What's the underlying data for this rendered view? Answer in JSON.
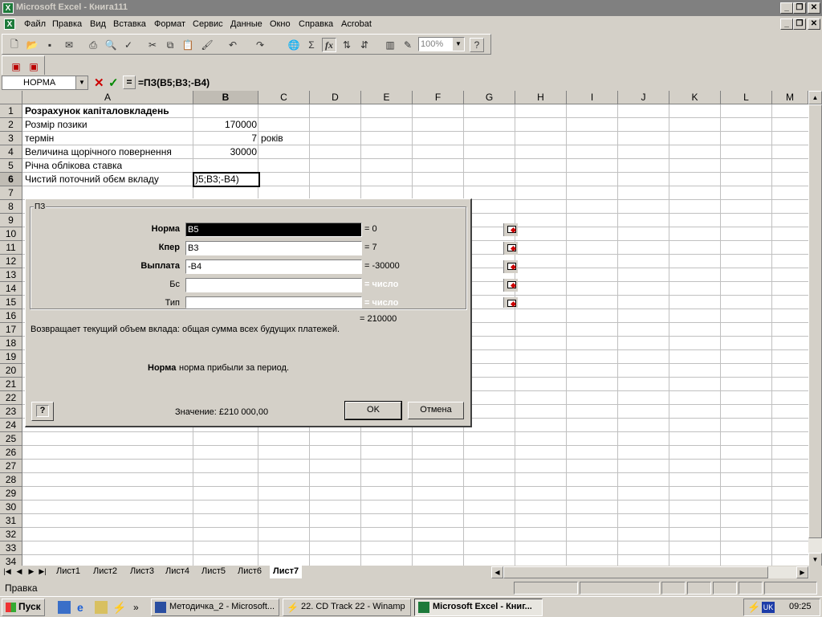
{
  "window": {
    "title": "Microsoft Excel - Книга111"
  },
  "menu": [
    "Файл",
    "Правка",
    "Вид",
    "Вставка",
    "Формат",
    "Сервис",
    "Данные",
    "Окно",
    "Справка",
    "Acrobat"
  ],
  "toolbar": {
    "zoom": "100%"
  },
  "formula_bar": {
    "name_box": "НОРМА",
    "equals": "=",
    "formula": "=ПЗ(B5;B3;-B4)"
  },
  "columns": [
    "A",
    "B",
    "C",
    "D",
    "E",
    "F",
    "G",
    "H",
    "I",
    "J",
    "K",
    "L",
    "M"
  ],
  "rows": [
    "1",
    "2",
    "3",
    "4",
    "5",
    "6",
    "7",
    "8",
    "9",
    "10",
    "11",
    "12",
    "13",
    "14",
    "15",
    "16",
    "17",
    "18",
    "19",
    "20",
    "21",
    "22",
    "23",
    "24",
    "25",
    "26",
    "27",
    "28",
    "29",
    "30",
    "31",
    "32",
    "33",
    "34"
  ],
  "cells": {
    "a1": "Розрахунок капіталовкладень",
    "a2": "Розмір позики",
    "b2": "170000",
    "a3": "термін",
    "b3": "7",
    "c3": "років",
    "a4": "Величина щорічного повернення",
    "b4": "30000",
    "a5": "Річна облікова ставка",
    "a6": "Чистий поточний обєм вкладу",
    "b6": ")5;B3;-B4)"
  },
  "dialog": {
    "group_label": "ПЗ",
    "args": [
      {
        "label": "Норма",
        "value": "B5",
        "result": "= 0",
        "bold": true
      },
      {
        "label": "Кпер",
        "value": "B3",
        "result": "= 7",
        "bold": true
      },
      {
        "label": "Выплата",
        "value": "-B4",
        "result": "= -30000",
        "bold": true
      },
      {
        "label": "Бс",
        "value": "",
        "result": "= число",
        "bold": false
      },
      {
        "label": "Тип",
        "value": "",
        "result": "= число",
        "bold": false
      }
    ],
    "total": "= 210000",
    "description": "Возвращает текущий объем вклада: общая сумма всех будущих платежей.",
    "arg_help_name": "Норма",
    "arg_help_text": "норма прибыли за период.",
    "value_text": "Значение: £210 000,00",
    "ok": "OK",
    "cancel": "Отмена",
    "help": "?"
  },
  "sheets": [
    "Лист1",
    "Лист2",
    "Лист3",
    "Лист4",
    "Лист5",
    "Лист6",
    "Лист7"
  ],
  "active_sheet": "Лист7",
  "status": {
    "mode": "Правка"
  },
  "taskbar": {
    "start": "Пуск",
    "buttons": [
      "Методичка_2 - Microsoft...",
      "22. CD Track 22 - Winamp",
      "Microsoft Excel - Книг..."
    ],
    "lang": "UK",
    "clock": "09:25"
  }
}
